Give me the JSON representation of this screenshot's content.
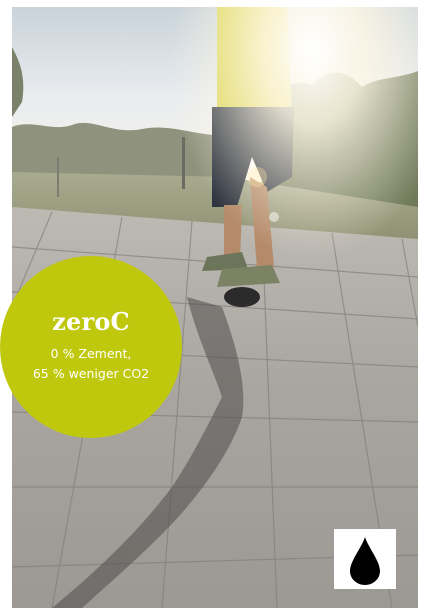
{
  "badge": {
    "title": "zeroC",
    "line1": "0 % Zement,",
    "line2": "65 % weniger CO2",
    "color": "#c0c80e"
  },
  "icons": {
    "product_marker": "water-drop-icon"
  },
  "colors": {
    "badge_background": "#c0c80e",
    "badge_text": "#ffffff",
    "drop_icon": "#000000"
  }
}
